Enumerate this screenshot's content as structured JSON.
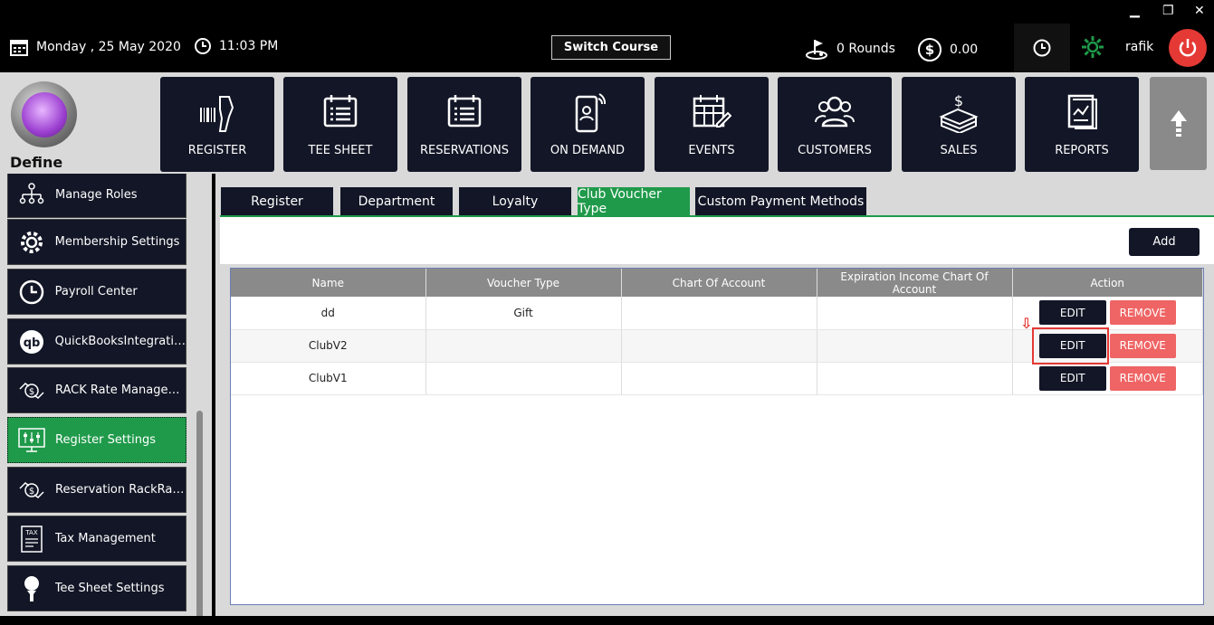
{
  "window": {
    "minimize": "▁",
    "restore": "❐",
    "close": "✕"
  },
  "topbar": {
    "date": "Monday ,  25 May 2020",
    "time": "11:03 PM",
    "switch_course": "Switch Course",
    "rounds": "0 Rounds",
    "amount": "0.00",
    "user": "rafik"
  },
  "logo": {
    "text": "Define"
  },
  "nav": [
    {
      "label": "REGISTER",
      "icon": "barcode-scanner-icon"
    },
    {
      "label": "TEE SHEET",
      "icon": "calendar-list-icon"
    },
    {
      "label": "RESERVATIONS",
      "icon": "calendar-list-icon"
    },
    {
      "label": "ON DEMAND",
      "icon": "mobile-user-icon"
    },
    {
      "label": "EVENTS",
      "icon": "calendar-edit-icon"
    },
    {
      "label": "CUSTOMERS",
      "icon": "users-icon"
    },
    {
      "label": "SALES",
      "icon": "money-stack-icon"
    },
    {
      "label": "REPORTS",
      "icon": "report-chart-icon"
    }
  ],
  "sidebar": {
    "items": [
      {
        "label": "Manage Roles"
      },
      {
        "label": "Membership Settings"
      },
      {
        "label": "Payroll Center"
      },
      {
        "label": "QuickBooksIntegration"
      },
      {
        "label": "RACK Rate Manageme..."
      },
      {
        "label": "Register Settings"
      },
      {
        "label": "Reservation RackRate..."
      },
      {
        "label": "Tax Management"
      },
      {
        "label": "Tee Sheet Settings"
      }
    ]
  },
  "tabs": [
    {
      "label": "Register"
    },
    {
      "label": "Department"
    },
    {
      "label": "Loyalty"
    },
    {
      "label": "Club Voucher Type"
    },
    {
      "label": "Custom Payment Methods"
    }
  ],
  "toolbar": {
    "add_label": "Add"
  },
  "table": {
    "headers": [
      "Name",
      "Voucher Type",
      "Chart Of Account",
      "Expiration Income Chart Of Account",
      "Action"
    ],
    "rows": [
      {
        "name": "dd",
        "voucher_type": "Gift",
        "chart": "",
        "exp_chart": ""
      },
      {
        "name": "ClubV2",
        "voucher_type": "",
        "chart": "",
        "exp_chart": ""
      },
      {
        "name": "ClubV1",
        "voucher_type": "",
        "chart": "",
        "exp_chart": ""
      }
    ],
    "edit_label": "EDIT",
    "remove_label": "REMOVE"
  },
  "annotation": {
    "arrow": "⇩"
  },
  "colors": {
    "accent": "#1f9a4a",
    "tile": "#121626",
    "danger": "#ef6464",
    "power": "#e53935"
  }
}
